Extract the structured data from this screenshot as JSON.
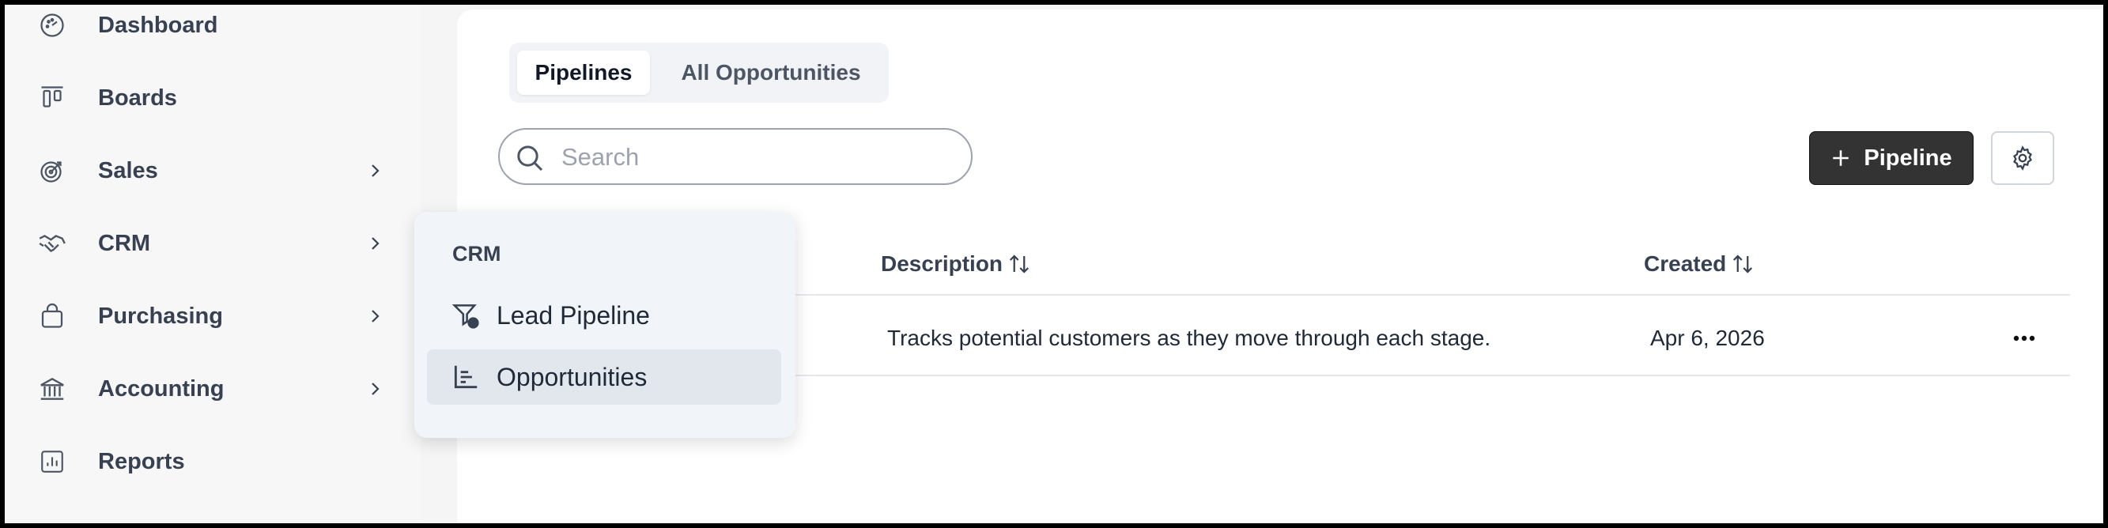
{
  "sidebar": {
    "items": [
      {
        "label": "Dashboard",
        "icon": "dashboard-icon"
      },
      {
        "label": "Boards",
        "icon": "boards-icon"
      },
      {
        "label": "Sales",
        "icon": "target-icon"
      },
      {
        "label": "CRM",
        "icon": "handshake-icon"
      },
      {
        "label": "Purchasing",
        "icon": "shopping-bag-icon"
      },
      {
        "label": "Accounting",
        "icon": "bank-icon"
      },
      {
        "label": "Reports",
        "icon": "report-chart-icon"
      }
    ]
  },
  "flyout": {
    "heading": "CRM",
    "items": [
      {
        "label": "Lead Pipeline",
        "icon": "funnel-dollar-icon",
        "selected": false
      },
      {
        "label": "Opportunities",
        "icon": "chart-bars-icon",
        "selected": true
      }
    ]
  },
  "tabs": [
    {
      "label": "Pipelines",
      "active": true
    },
    {
      "label": "All Opportunities",
      "active": false
    }
  ],
  "search": {
    "placeholder": "Search",
    "value": ""
  },
  "toolbar": {
    "add_label": "Pipeline"
  },
  "table": {
    "columns": [
      "Description",
      "Created"
    ],
    "rows": [
      {
        "description": "Tracks potential customers as they move through each stage.",
        "created": "Apr 6, 2026"
      }
    ]
  },
  "colors": {
    "primary_button": "#333333",
    "sidebar_bg": "#f7f7f8",
    "flyout_bg": "#f1f4f8",
    "selected_item": "#e2e7ee"
  }
}
